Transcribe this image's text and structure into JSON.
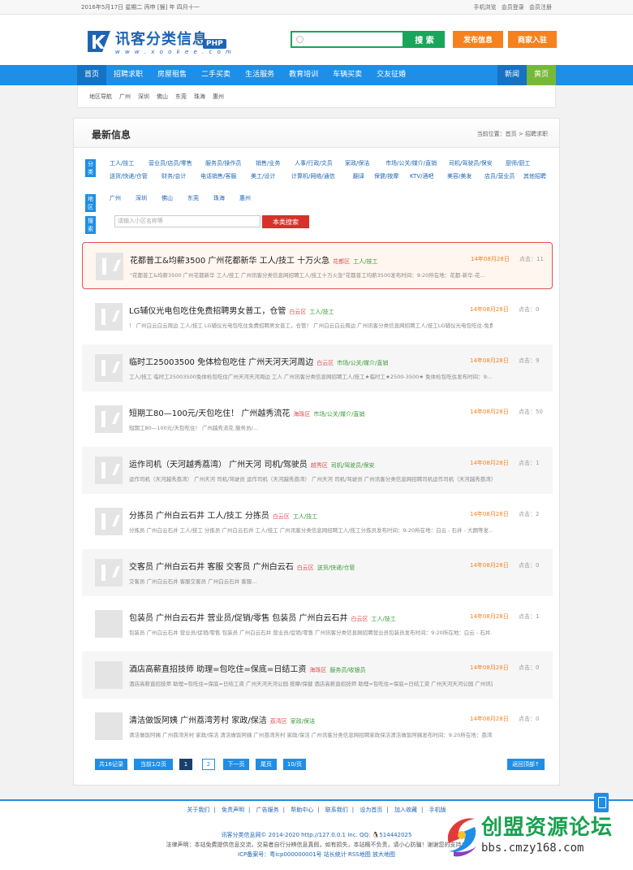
{
  "topbar": {
    "date": "2016年5月17日 星期二 丙申 [猴] 年 四月十一",
    "links": [
      "手机浏览",
      "会员登录",
      "会员注册"
    ]
  },
  "header": {
    "logo_title": "讯客分类信息",
    "logo_url": "w w w . x o o k e e . c o m",
    "logo_badge": "PHP",
    "search_placeholder": "",
    "search_button": "搜 索",
    "post_button": "发布信息",
    "merchant_button": "商家入驻"
  },
  "nav": {
    "items": [
      "首页",
      "招聘求职",
      "房屋租售",
      "二手买卖",
      "生活服务",
      "教育培训",
      "车辆买卖",
      "交友征婚"
    ],
    "right": [
      "新闻",
      "黄页"
    ]
  },
  "subnav": {
    "items": [
      "地区导航",
      "广州",
      "深圳",
      "佛山",
      "东莞",
      "珠海",
      "惠州"
    ]
  },
  "main": {
    "title": "最新信息",
    "breadcrumb": "当前位置：首页 > 招聘求职"
  },
  "filters": {
    "category_label": "分类",
    "categories_row1": [
      "工人/技工",
      "营业员/店员/零售",
      "服务员/操作员",
      "销售/业务",
      "人事/行政/文员",
      "家政/保洁",
      "市场/公关/媒介/直销",
      "司机/驾驶员/保安",
      "厨师/厨工"
    ],
    "categories_row2": [
      "送货/快递/仓管",
      "财务/会计",
      "电话销售/客服",
      "美工/设计",
      "计算机/网络/通信",
      "翻译",
      "保健/按摩",
      "KTV/酒吧",
      "美容/美发",
      "店员/营业员",
      "其他招聘"
    ],
    "region_label": "地区",
    "regions": [
      "广州",
      "深圳",
      "佛山",
      "东莞",
      "珠海",
      "惠州"
    ],
    "keyword_label": "搜索",
    "keyword_placeholder": "请输入小区名称等",
    "keyword_button": "本类搜索"
  },
  "listings": [
    {
      "title": "花都普工&均薪3500 广州花都新华 工人/技工 十万火急",
      "area": "花都区",
      "category": "工人/技工",
      "desc": "\"花都普工&均薪3500 广州花都新华 工人/技工 广州讯客分类信息网招聘工人/技工十万火急\"花都普工均薪3500发布时间：9:20所在地：花都-新华-花...",
      "date": "14年08月28日",
      "hits": "点击：11"
    },
    {
      "title": "LG辅仪光电包吃住免费招聘男女普工，仓管",
      "area": "白云区",
      "category": "工人/技工",
      "desc": "！ 广州白云白云周边 工人/技工 LG辅仪光电包吃住免费招聘男女普工，仓管！ 广州白云白云周边 广州讯客分类信息网招聘工人/技工LG辅仪光电包吃住-免费招聘...",
      "date": "14年08月28日",
      "hits": "点击：0"
    },
    {
      "title": "临时工25003500 免体检包吃住 广州天河天河周边",
      "area": "白云区",
      "category": "市场/公关/媒介/直销",
      "desc": "工人/技工 临时工25003500免体检包吃住广州天河天河周边 工人 广州讯客分类信息网招聘工人/技工★临时工★2500-3500★ 免体检包吃住发布时间：9:...",
      "date": "14年08月28日",
      "hits": "点击：9"
    },
    {
      "title": "短期工80—100元/天包吃住！ 广州越秀流花",
      "area": "海珠区",
      "category": "市场/公关/媒介/直销",
      "desc": "短期工80—100元/天包吃住！ 广州越秀流花 服务员/...",
      "date": "14年08月28日",
      "hits": "点击：50"
    },
    {
      "title": "运作司机（天河越秀荔湾） 广州天河 司机/驾驶员",
      "area": "越秀区",
      "category": "司机/驾驶员/保安",
      "desc": "运作司机（天河越秀荔湾） 广州天河 司机/驾驶员 运作司机（天河越秀荔湾） 广州天河 司机/驾驶员 广州讯客分类信息网招聘司机运作司机（天河越秀荔湾）发布时间：9...",
      "date": "14年08月28日",
      "hits": "点击：1"
    },
    {
      "title": "分拣员 广州白云石井 工人/技工 分拣员",
      "area": "白云区",
      "category": "工人/技工",
      "desc": "分拣员 广州白云石井 工人/技工 分拣员 广州白云石井 工人/技工 广州讯客分类信息网招聘工人/技工分拣员发布时间：9:20所在地：白云 - 石井 - 大朗等发...",
      "date": "14年08月28日",
      "hits": "点击：2"
    },
    {
      "title": "交客员 广州白云石井 客服 交客员 广州白云石",
      "area": "白云区",
      "category": "送货/快递/仓管",
      "desc": "交客员 广州白云石井 客服交客员 广州白云石井 客服...",
      "date": "14年08月28日",
      "hits": "点击：0"
    },
    {
      "title": "包装员 广州白云石井 营业员/促销/零售 包装员 广州白云石井",
      "area": "白云区",
      "category": "工人/技工",
      "desc": "包装员 广州白云石井 营业员/促销/零售 包装员 广州白云石井 营业员/促销/零售 广州讯客分类信息网招聘营业员包装员发布时间：9:20所在地：白云 - 石井...",
      "date": "14年08月28日",
      "hits": "点击：1"
    },
    {
      "title": "酒店高薪直招技师 助理=包吃住=保底=日结工资",
      "area": "海珠区",
      "category": "服务员/收银员",
      "desc": "酒店高薪直招技师 助理=包吃住=保底=日结工资 广州天河天河公园 按摩/保健 酒店高薪直招技师 助理=包吃住=保底=日结工资 广州天河天河公园 广州讯客分类信息网招...",
      "date": "14年08月28日",
      "hits": "点击：0"
    },
    {
      "title": "清洁做饭阿姨 广州荔湾芳村 家政/保洁",
      "area": "荔湾区",
      "category": "家政/保洁",
      "desc": "清洁做饭阿姨 广州荔湾芳村 家政/保洁 清洁做饭阿姨 广州荔湾芳村 家政/保洁 广州讯客分类信息网招聘家政保洁清洁做饭阿姨发布时间：9:20所在地：荔湾 - ...",
      "date": "14年08月28日",
      "hits": "点击：0"
    }
  ],
  "pager": {
    "total": "共16记录",
    "current_of": "当前1/2页",
    "pages": [
      "1",
      "2"
    ],
    "next": "下一页",
    "last": "尾页",
    "per": "10/页",
    "back_top": "返回顶部↑"
  },
  "footer": {
    "links": [
      "关于我们",
      "免责声明",
      "广告服务",
      "帮助中心",
      "联系我们",
      "设为首页",
      "加入收藏",
      "手机版"
    ],
    "line1": "讯客分类信息网© 2014-2020 http://127.0.0.1 Inc. QQ: 🐧514442025",
    "line2": "法律声明：本站免费提供信息交流，交易者自行分辨信息真假，如有损失，本站概不负责，请小心防骗！谢谢您的支持！",
    "line3": "ICP备案号：粤icp000000001号 站长统计 RSS地图 放大地图"
  },
  "watermark": {
    "brand": "创盟资源论坛",
    "url": "bbs.cmzy168.com"
  },
  "colors": {
    "nav_blue": "#1e8ee6",
    "search_green": "#19a55a",
    "button_orange": "#f5821e",
    "date_orange": "#f5821e",
    "highlight_red": "#e05050"
  }
}
